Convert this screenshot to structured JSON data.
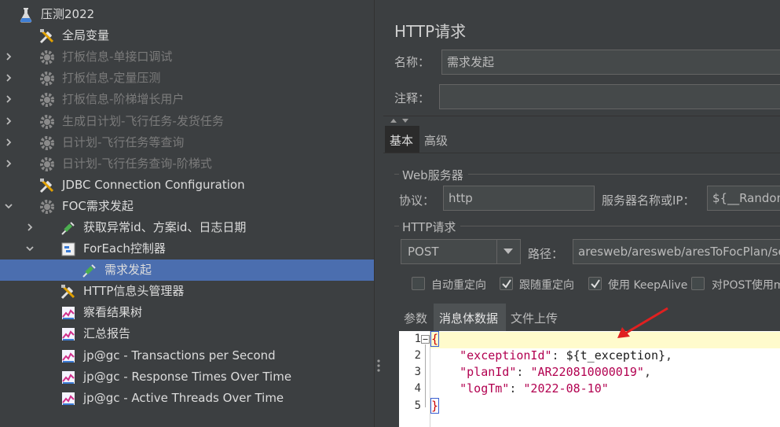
{
  "tree": {
    "items": [
      {
        "label": "压测2022",
        "icon": "test-plan-icon",
        "state": "expanded"
      },
      {
        "label": "全局变量",
        "icon": "config-element-icon",
        "state": "none"
      },
      {
        "label": "打板信息-单接口调试",
        "icon": "thread-group-icon",
        "state": "collapsed",
        "disabled": true
      },
      {
        "label": "打板信息-定量压测",
        "icon": "thread-group-icon",
        "state": "collapsed",
        "disabled": true
      },
      {
        "label": "打板信息-阶梯增长用户",
        "icon": "thread-group-icon",
        "state": "collapsed",
        "disabled": true
      },
      {
        "label": "生成日计划-飞行任务-发货任务",
        "icon": "thread-group-icon",
        "state": "collapsed",
        "disabled": true
      },
      {
        "label": "日计划-飞行任务等查询",
        "icon": "thread-group-icon",
        "state": "collapsed",
        "disabled": true
      },
      {
        "label": "日计划-飞行任务查询-阶梯式",
        "icon": "thread-group-icon",
        "state": "collapsed",
        "disabled": true
      },
      {
        "label": "JDBC Connection Configuration",
        "icon": "config-element-icon",
        "state": "none"
      },
      {
        "label": "FOC需求发起",
        "icon": "thread-group-icon",
        "state": "expanded"
      },
      {
        "label": "获取异常id、方案id、日志日期",
        "icon": "sampler-icon",
        "state": "collapsed"
      },
      {
        "label": "ForEach控制器",
        "icon": "controller-icon",
        "state": "expanded"
      },
      {
        "label": "需求发起",
        "icon": "sampler-icon",
        "state": "none",
        "selected": true
      },
      {
        "label": "HTTP信息头管理器",
        "icon": "config-element-icon",
        "state": "none"
      },
      {
        "label": "察看结果树",
        "icon": "listener-icon",
        "state": "none"
      },
      {
        "label": "汇总报告",
        "icon": "listener-icon",
        "state": "none"
      },
      {
        "label": "jp@gc - Transactions per Second",
        "icon": "listener-icon",
        "state": "none"
      },
      {
        "label": "jp@gc - Response Times Over Time",
        "icon": "listener-icon",
        "state": "none"
      },
      {
        "label": "jp@gc - Active Threads Over Time",
        "icon": "listener-icon",
        "state": "none"
      }
    ]
  },
  "panel": {
    "title": "HTTP请求",
    "name_label": "名称：",
    "name_value": "需求发起",
    "comment_label": "注释：",
    "comment_value": "",
    "tabs": {
      "basic": "基本",
      "advanced": "高级"
    },
    "web_server": {
      "section": "Web服务器",
      "protocol_label": "协议：",
      "protocol_value": "http",
      "server_label": "服务器名称或IP：",
      "server_value": "${__Random"
    },
    "http_request": {
      "section": "HTTP请求",
      "method": "POST",
      "path_label": "路径：",
      "path_value": "aresweb/aresweb/aresToFocPlan/sen"
    },
    "options": {
      "auto_redirect": {
        "label": "自动重定向",
        "checked": false
      },
      "follow_redirect": {
        "label": "跟随重定向",
        "checked": true
      },
      "keepalive": {
        "label": "使用 KeepAlive",
        "checked": true
      },
      "multipart": {
        "label": "对POST使用m",
        "checked": false
      }
    },
    "subtabs": {
      "params": "参数",
      "body": "消息体数据",
      "files": "文件上传"
    },
    "body_lines": [
      {
        "n": "1",
        "text": "{"
      },
      {
        "n": "2",
        "key": "\"exceptionId\"",
        "sep": ": ",
        "val": "${t_exception}",
        "end": ","
      },
      {
        "n": "3",
        "key": "\"planId\"",
        "sep": ": ",
        "val": "\"AR220810000019\"",
        "end": ","
      },
      {
        "n": "4",
        "key": "\"logTm\"",
        "sep": ": ",
        "val": "\"2022-08-10\"",
        "end": ""
      },
      {
        "n": "5",
        "text": "}"
      }
    ]
  },
  "colors": {
    "selection": "#4b6eaf",
    "annotation_arrow": "#e02020",
    "current_line": "#fffbcc"
  }
}
